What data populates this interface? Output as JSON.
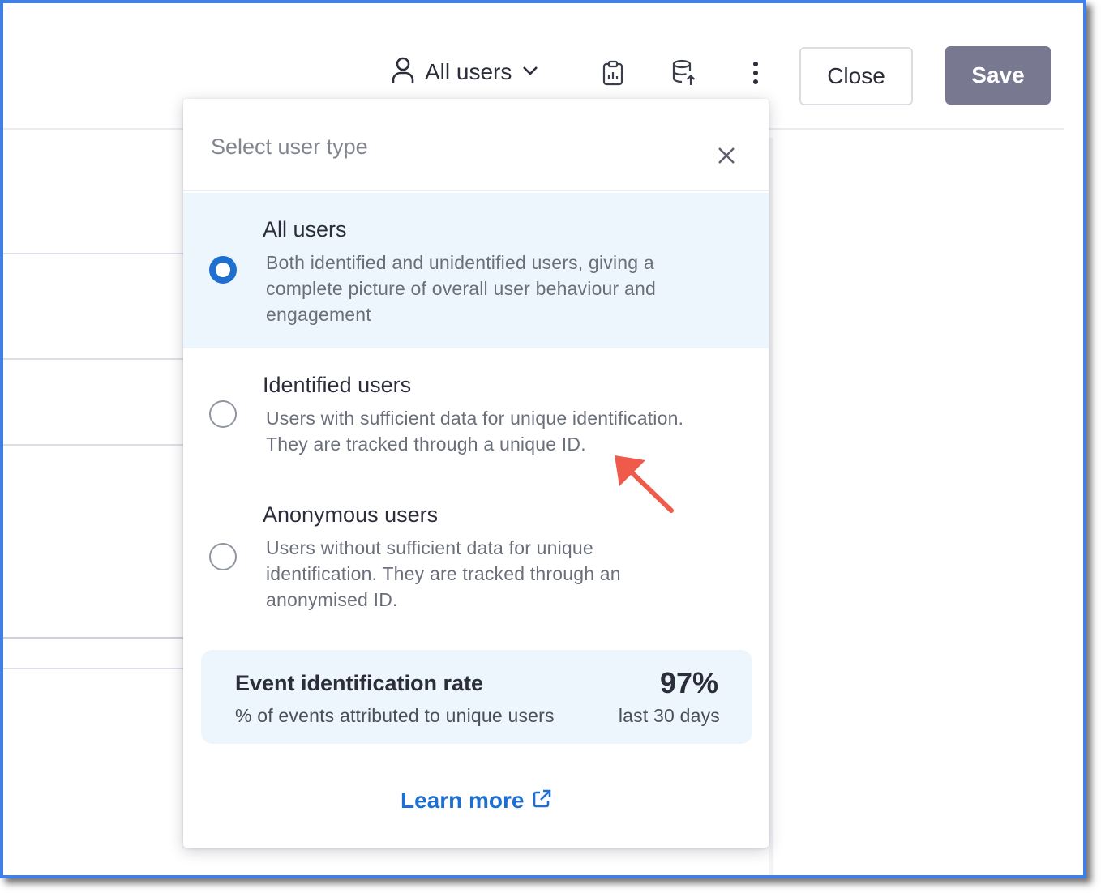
{
  "toolbar": {
    "user_type_label": "All users",
    "close_label": "Close",
    "save_label": "Save",
    "icons": [
      "user-icon",
      "chevron-down-icon",
      "clipboard-chart-icon",
      "database-upload-icon",
      "more-vertical-icon"
    ]
  },
  "popover": {
    "title": "Select user type",
    "options": [
      {
        "title": "All users",
        "description_lines": [
          "Both identified and unidentified users, giving a",
          "complete picture of overall user behaviour and",
          "engagement"
        ],
        "selected": true
      },
      {
        "title": "Identified users",
        "description_lines": [
          "Users with sufficient data for unique identification.",
          "They are tracked through a unique ID."
        ],
        "selected": false
      },
      {
        "title": "Anonymous users",
        "description_lines": [
          "Users without sufficient data for unique",
          "identification. They are tracked through an",
          "anonymised ID."
        ],
        "selected": false
      }
    ],
    "rate": {
      "title": "Event identification rate",
      "subtitle": "% of events attributed to unique users",
      "value": "97%",
      "period": "last 30 days"
    },
    "learn_more": "Learn more"
  },
  "colors": {
    "accent": "#1f6fd0",
    "save_bg": "#787890",
    "selected_bg": "#eef6fd",
    "frame_border": "#3f7fe6",
    "annotation_arrow": "#ef5a4b"
  }
}
